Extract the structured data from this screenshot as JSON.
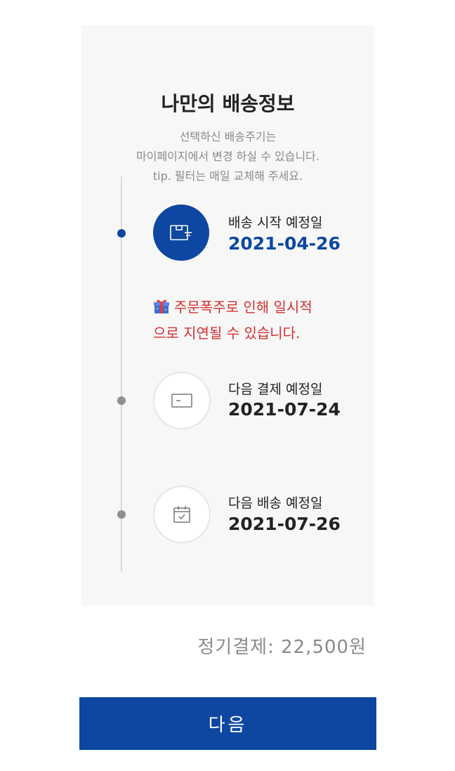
{
  "card": {
    "title": "나만의 배송정보",
    "subtitle_lines": [
      "선택하신 배송주기는",
      "마이페이지에서 변경 하실 수 있습니다.",
      "tip. 필터는 매일 교체해 주세요."
    ]
  },
  "timeline": [
    {
      "label": "배송 시작 예정일",
      "date": "2021-04-26",
      "icon": "package-icon",
      "active": true
    },
    {
      "label": "다음 결제 예정일",
      "date": "2021-07-24",
      "icon": "credit-card-icon",
      "active": false
    },
    {
      "label": "다음 배송 예정일",
      "date": "2021-07-26",
      "icon": "calendar-check-icon",
      "active": false
    }
  ],
  "warning": {
    "icon": "gift-icon",
    "lines": [
      "주문폭주로 인해 일시적",
      "으로 지연될 수 있습니다."
    ]
  },
  "payment": {
    "text": "정기결제: 22,500원"
  },
  "button": {
    "label": "다음"
  },
  "colors": {
    "accent": "#0d47a1",
    "warning": "#d32f2f",
    "card_bg": "#f7f7f7"
  }
}
